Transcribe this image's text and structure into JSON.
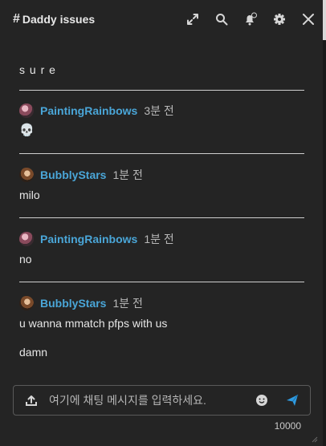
{
  "channel": {
    "hash": "#",
    "name": "Daddy issues"
  },
  "header_icons": [
    "expand-icon",
    "search-icon",
    "bell-icon",
    "gear-icon",
    "close-icon"
  ],
  "messages": [
    {
      "text": "s u r e"
    },
    {
      "author": "PaintingRainbows",
      "time": "3분 전",
      "text": "💀"
    },
    {
      "author": "BubblyStars",
      "time": "1분 전",
      "text": "milo"
    },
    {
      "author": "PaintingRainbows",
      "time": "1분 전",
      "text": "no"
    },
    {
      "author": "BubblyStars",
      "time": "1분 전",
      "text": "u wanna mmatch pfps with us",
      "text2": "damn"
    }
  ],
  "composer": {
    "placeholder": "여기에 채팅 메시지를 입력하세요.",
    "value": "",
    "counter": "10000"
  },
  "colors": {
    "background": "#242424",
    "author": "#4aa6d8",
    "send": "#2f9be0",
    "divider": "#cfcfcf"
  }
}
